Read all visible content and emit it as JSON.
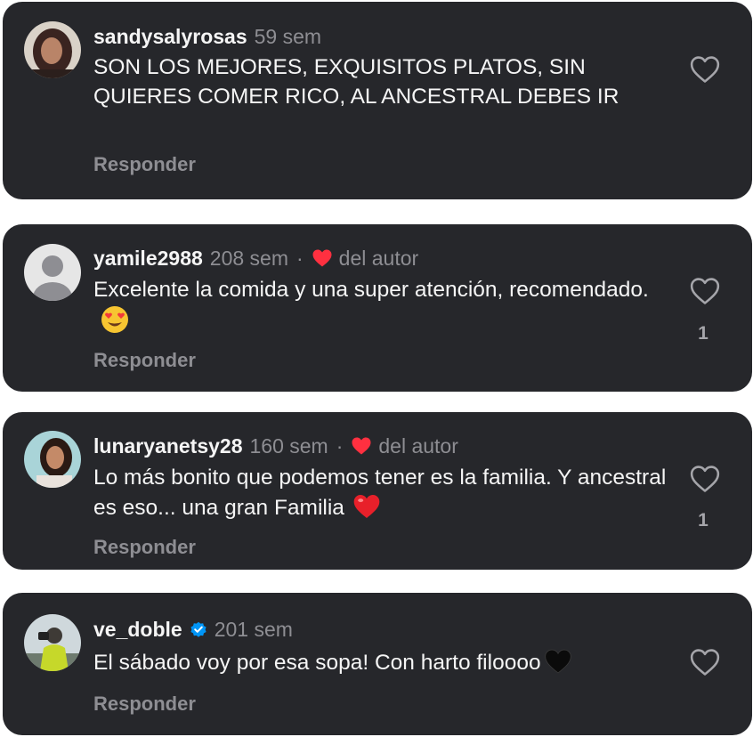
{
  "comments": [
    {
      "username": "sandysalyrosas",
      "time": "59 sem",
      "text": "SON LOS MEJORES, EXQUISITOS PLATOS, SIN QUIERES COMER RICO, AL ANCESTRAL DEBES IR",
      "reply_label": "Responder",
      "liked_by_author": false,
      "like_count": ""
    },
    {
      "username": "yamile2988",
      "time": "208 sem",
      "dot": "·",
      "author_like_label": "del autor",
      "text": "Excelente la comida y una super atención, recomendado.",
      "emoji": "heart-eyes-emoji",
      "reply_label": "Responder",
      "liked_by_author": true,
      "like_count": "1"
    },
    {
      "username": "lunaryanetsy28",
      "time": "160 sem",
      "dot": "·",
      "author_like_label": "del autor",
      "text": "Lo más bonito que podemos tener es la familia. Y ancestral es eso... una gran Familia",
      "emoji": "red-heart-emoji",
      "reply_label": "Responder",
      "liked_by_author": true,
      "like_count": "1"
    },
    {
      "username": "ve_doble",
      "verified": true,
      "time": "201 sem",
      "text": "El sábado voy por esa sopa! Con harto filoooo",
      "emoji": "black-heart-emoji",
      "reply_label": "Responder",
      "liked_by_author": false,
      "like_count": ""
    }
  ],
  "colors": {
    "card_background": "#26272b",
    "text_primary": "#f5f5f5",
    "text_secondary": "#8e8e93",
    "author_heart": "#ff3040",
    "verified_badge": "#0095f6"
  }
}
